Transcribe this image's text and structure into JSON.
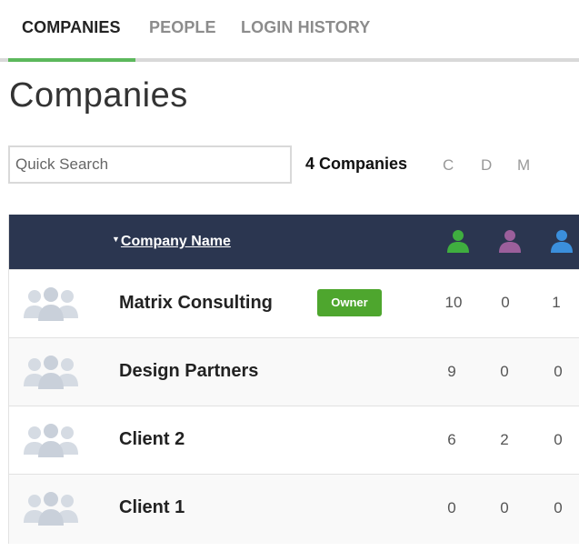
{
  "tabs": [
    {
      "label": "COMPANIES",
      "active": true
    },
    {
      "label": "PEOPLE",
      "active": false
    },
    {
      "label": "LOGIN HISTORY",
      "active": false
    }
  ],
  "page_title": "Companies",
  "search": {
    "placeholder": "Quick Search",
    "value": ""
  },
  "count_label": "4 Companies",
  "filters": [
    "C",
    "D",
    "M"
  ],
  "table": {
    "sort_column": "Company Name",
    "role_icons": [
      {
        "name": "green-user-icon",
        "color": "#3fae3f"
      },
      {
        "name": "purple-user-icon",
        "color": "#9b5f9b"
      },
      {
        "name": "blue-user-icon",
        "color": "#3b8fdc"
      }
    ],
    "rows": [
      {
        "name": "Matrix Consulting",
        "badge": "Owner",
        "c": "10",
        "d": "0",
        "m": "1"
      },
      {
        "name": "Design Partners",
        "badge": "",
        "c": "9",
        "d": "0",
        "m": "0"
      },
      {
        "name": "Client 2",
        "badge": "",
        "c": "6",
        "d": "2",
        "m": "0"
      },
      {
        "name": "Client 1",
        "badge": "",
        "c": "0",
        "d": "0",
        "m": "0"
      }
    ]
  },
  "colors": {
    "accent": "#5cb85c",
    "header_bg": "#2b3650",
    "owner_badge": "#4ea62e",
    "placeholder_logo": "#d5dbe3"
  }
}
